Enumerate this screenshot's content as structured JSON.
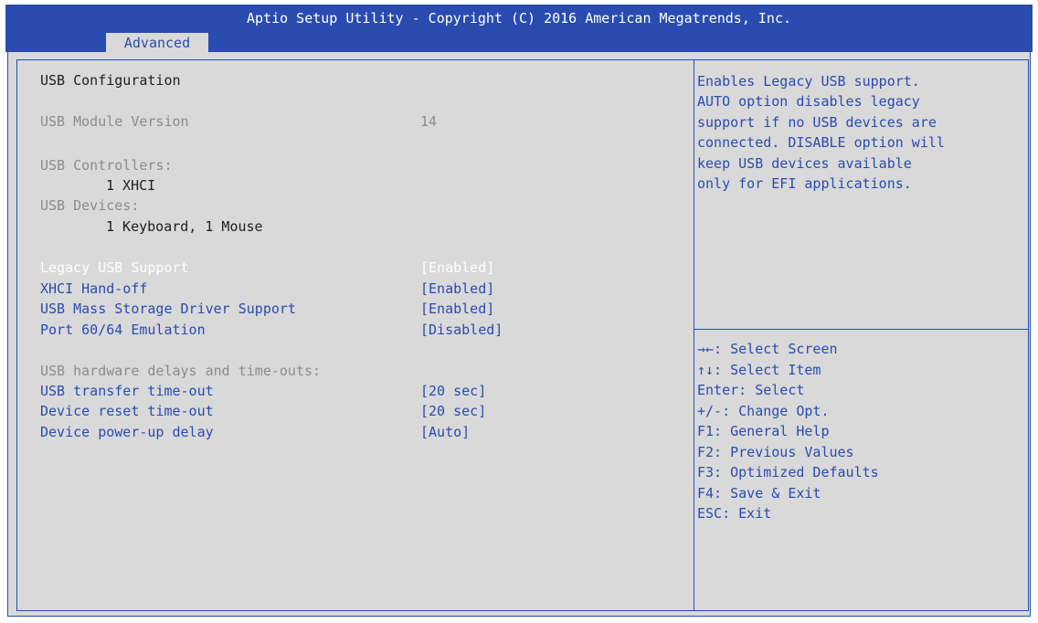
{
  "header": {
    "title": "Aptio Setup Utility - Copyright (C) 2016 American Megatrends, Inc.",
    "tab": "Advanced"
  },
  "main": {
    "section_title": "USB Configuration",
    "module_version_label": "USB Module Version",
    "module_version_value": "14",
    "controllers_label": "USB Controllers:",
    "controllers_value": "1 XHCI",
    "devices_label": "USB Devices:",
    "devices_value": "1 Keyboard, 1 Mouse",
    "settings": [
      {
        "label": "Legacy USB Support",
        "value": "[Enabled]",
        "selected": true
      },
      {
        "label": "XHCI Hand-off",
        "value": "[Enabled]"
      },
      {
        "label": "USB Mass Storage Driver Support",
        "value": "[Enabled]"
      },
      {
        "label": "Port 60/64 Emulation",
        "value": "[Disabled]"
      }
    ],
    "delays_header": "USB hardware delays and time-outs:",
    "delays": [
      {
        "label": "USB transfer time-out",
        "value": "[20 sec]"
      },
      {
        "label": "Device reset time-out",
        "value": "[20 sec]"
      },
      {
        "label": "Device power-up delay",
        "value": "[Auto]"
      }
    ]
  },
  "help": {
    "lines": [
      "Enables Legacy USB support.",
      "AUTO option disables legacy",
      "support if no USB devices are",
      "connected. DISABLE option will",
      "keep USB devices available",
      "only for EFI applications."
    ]
  },
  "keys": [
    "→←: Select Screen",
    "↑↓: Select Item",
    "Enter: Select",
    "+/-: Change Opt.",
    "F1: General Help",
    "F2: Previous Values",
    "F3: Optimized Defaults",
    "F4: Save & Exit",
    "ESC: Exit"
  ],
  "colors": {
    "accent": "#2a4cb0",
    "background": "#d9d9d9",
    "disabled_text": "#8c8c8c",
    "selected_text": "#ffffff"
  }
}
